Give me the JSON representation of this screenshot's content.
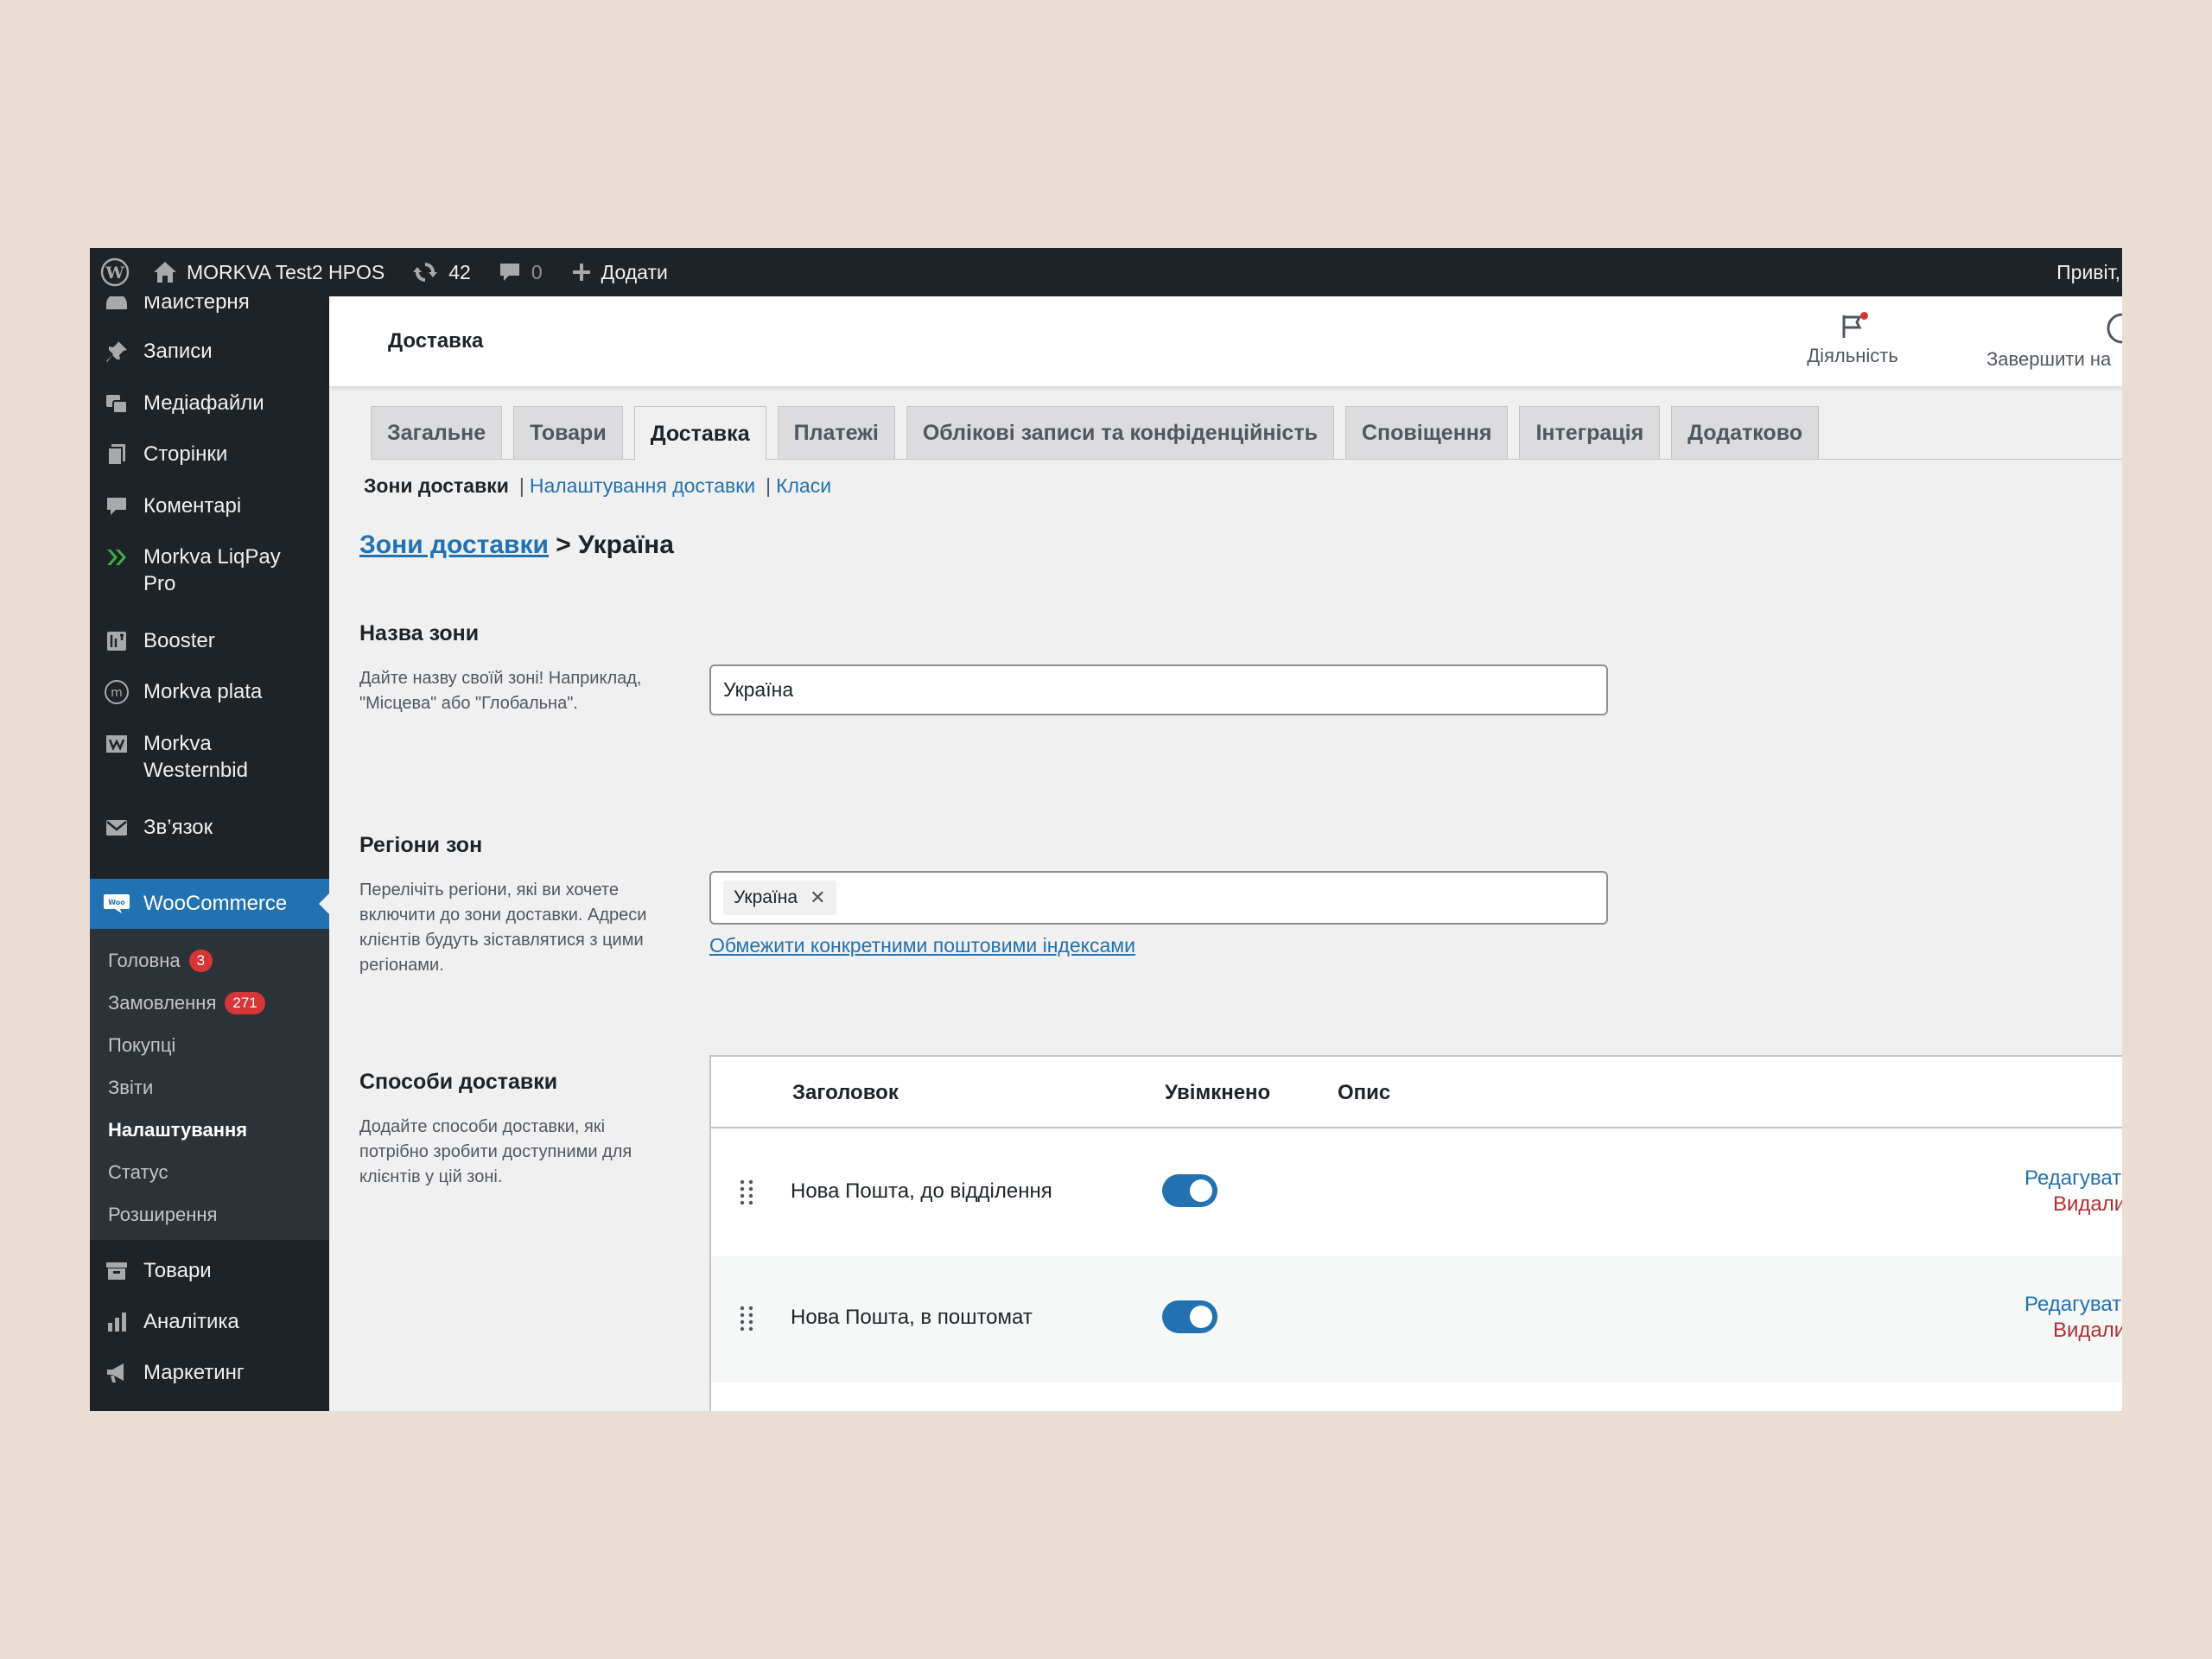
{
  "admin_bar": {
    "site_name": "MORKVA Test2 HPOS",
    "updates_count": "42",
    "comments_count": "0",
    "add_new": "Додати",
    "greeting": "Привіт,"
  },
  "sidebar": {
    "items": [
      {
        "label": "Майстерня",
        "icon": "dashboard-icon"
      },
      {
        "label": "Записи",
        "icon": "pin-icon"
      },
      {
        "label": "Медіафайли",
        "icon": "media-icon"
      },
      {
        "label": "Сторінки",
        "icon": "pages-icon"
      },
      {
        "label": "Коментарі",
        "icon": "comment-icon"
      },
      {
        "label": "Morkva LiqPay Pro",
        "icon": "liqpay-icon"
      },
      {
        "label": "Booster",
        "icon": "booster-icon"
      },
      {
        "label": "Morkva plata",
        "icon": "plata-icon"
      },
      {
        "label": "Morkva Westernbid",
        "icon": "westernbid-icon"
      },
      {
        "label": "Зв’язок",
        "icon": "mail-icon"
      },
      {
        "label": "WooCommerce",
        "icon": "woo-icon"
      },
      {
        "label": "Товари",
        "icon": "archive-icon"
      },
      {
        "label": "Аналітика",
        "icon": "bar-chart-icon"
      },
      {
        "label": "Маркетинг",
        "icon": "megaphone-icon"
      }
    ],
    "woo_submenu": [
      {
        "label": "Головна",
        "badge": "3"
      },
      {
        "label": "Замовлення",
        "badge": "271"
      },
      {
        "label": "Покупці"
      },
      {
        "label": "Звіти"
      },
      {
        "label": "Налаштування",
        "current": true
      },
      {
        "label": "Статус"
      },
      {
        "label": "Розширення"
      }
    ]
  },
  "header": {
    "title": "Доставка",
    "activity": "Діяльність",
    "finish_setup": "Завершити на"
  },
  "tabs": [
    "Загальне",
    "Товари",
    "Доставка",
    "Платежі",
    "Облікові записи та конфіденційність",
    "Сповіщення",
    "Інтеграція",
    "Додатково"
  ],
  "active_tab": "Доставка",
  "subnav": {
    "current": "Зони доставки",
    "links": [
      "Налаштування доставки",
      "Класи"
    ],
    "separator": "|"
  },
  "breadcrumb": {
    "link": "Зони доставки",
    "current": "> Україна"
  },
  "zone_name": {
    "title": "Назва зони",
    "description": "Дайте назву своїй зоні! Наприклад, \"Місцева\" або \"Глобальна\".",
    "value": "Україна"
  },
  "zone_regions": {
    "title": "Регіони зон",
    "description": "Перелічіть регіони, які ви хочете включити до зони доставки. Адреси клієнтів будуть зіставлятися з цими регіонами.",
    "chip": "Україна",
    "postcode_link": "Обмежити конкретними поштовими індексами"
  },
  "shipping_methods": {
    "title": "Способи доставки",
    "description": "Додайте способи доставки, які потрібно зробити доступними для клієнтів у цій зоні.",
    "columns": [
      "Заголовок",
      "Увімкнено",
      "Опис"
    ],
    "rows": [
      {
        "name": "Нова Пошта, до відділення",
        "enabled": true,
        "edit": "Редагувати",
        "delete": "Видалити"
      },
      {
        "name": "Нова Пошта, в поштомат",
        "enabled": true,
        "edit": "Редагувати",
        "delete": "Видалити"
      }
    ]
  },
  "colors": {
    "admin_dark": "#1d2327",
    "accent": "#2271b1",
    "danger": "#b32d2e",
    "badge": "#d63638",
    "background": "#eaddd3"
  }
}
